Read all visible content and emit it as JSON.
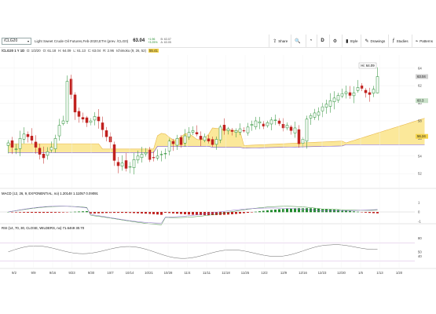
{
  "toolbar": {
    "symbol": "/CLG20",
    "description": "Light Sweet Crude Oil Futures,Feb-2020,ETH (prev. /CLG0)",
    "last_price": "63.04",
    "change_lines": [
      "+1.96",
      "+3.25%"
    ],
    "bidask_lines": [
      "B: 63.07",
      "A: 63.05"
    ],
    "buttons": {
      "share": "Share",
      "style": "Style",
      "drawings": "Drawings",
      "studies": "Studies",
      "patterns": "Patterns"
    }
  },
  "info": {
    "label": "/CLG20 1 Y 1D",
    "date": "D: 1/3/20",
    "open": "O: 61.18",
    "high": "H: 64.09",
    "low": "L: 61.13",
    "close": "C: 63.04",
    "range": "R: 2.96",
    "study": "Ichimoku (9, 26, 52)",
    "tag": "55.41"
  },
  "price_panel": {
    "hi_label": "Hi: 64.09",
    "right_labels": [
      {
        "price": 63.04,
        "text": "63.04",
        "color": "#222222",
        "bg": "#d0d0d0"
      },
      {
        "price": 60.3,
        "text": "60.3",
        "color": "#222222",
        "bg": "#c8e0c8"
      },
      {
        "price": 56.24,
        "text": "56.24",
        "color": "#222222",
        "bg": "#f2d24a"
      }
    ],
    "y_ticks": [
      "52",
      "54",
      "56",
      "58",
      "60",
      "62",
      "64"
    ]
  },
  "macd_panel": {
    "label": "MACD (12, 26, 9, EXPONENTIAL, no) 1.20148  1.11057  0.09091",
    "right_labels": [
      "1",
      "0",
      "-1"
    ],
    "value_tag": "0.09091"
  },
  "rsi_panel": {
    "label": "RSI (14, 70, 30, CLOSE, WILDERS, no) 71.6469  30.70",
    "right_labels": [
      "80",
      "50",
      "40"
    ]
  },
  "x_axis": [
    "9/2",
    "9/9",
    "9/16",
    "9/23",
    "9/30",
    "10/7",
    "10/14",
    "10/21",
    "10/28",
    "11/4",
    "11/11",
    "11/18",
    "11/25",
    "12/2",
    "12/9",
    "12/16",
    "12/23",
    "12/30",
    "1/6",
    "1/13",
    "1/20"
  ],
  "colors": {
    "up": "#1f8a2b",
    "down": "#c0211f",
    "cloud_red": "#f6b4b0",
    "cloud_yellow": "#fbe89a",
    "kijun": "#7a5ac8",
    "accent": "#2a5fd6"
  }
}
